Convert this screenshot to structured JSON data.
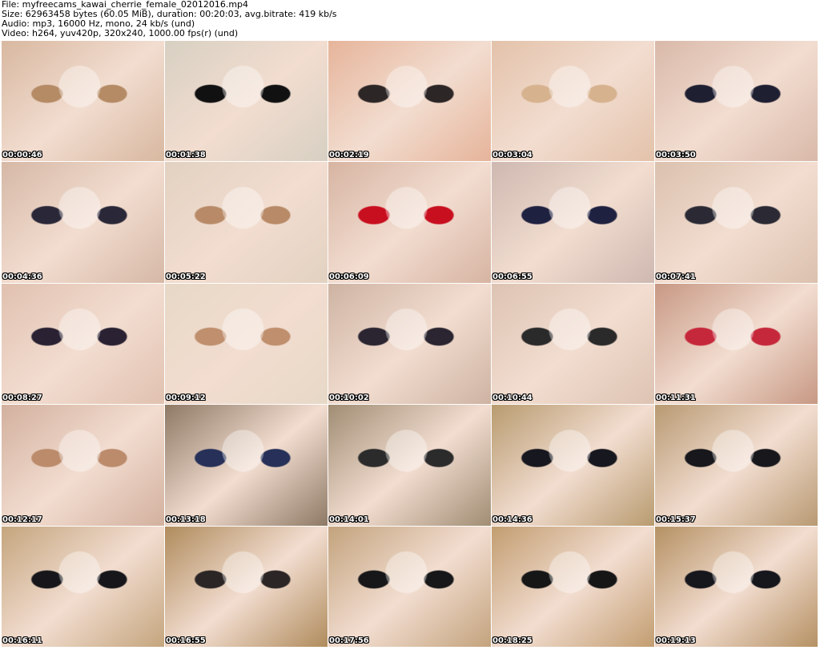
{
  "header": {
    "file_line": "File: myfreecams_kawai_cherrie_female_02012016.mp4",
    "size_line": "Size: 62963458 bytes (60.05 MiB), duration: 00:20:03, avg.bitrate: 419 kb/s",
    "audio_line": "Audio: mp3, 16000 Hz, mono, 24 kb/s (und)",
    "video_line": "Video: h264, yuv420p, 320x240, 1000.00 fps(r) (und)"
  },
  "thumbnails": [
    {
      "time": "00:00:46",
      "bg": "#d8b8a0",
      "accent": "#b58b66"
    },
    {
      "time": "00:01:38",
      "bg": "#d7d0c2",
      "accent": "#111111"
    },
    {
      "time": "00:02:19",
      "bg": "#e6b49a",
      "accent": "#2d2626"
    },
    {
      "time": "00:03:04",
      "bg": "#e3c2aa",
      "accent": "#d7b28f"
    },
    {
      "time": "00:03:50",
      "bg": "#d9b9a9",
      "accent": "#1f1f32"
    },
    {
      "time": "00:04:36",
      "bg": "#d6b8a6",
      "accent": "#2a2738"
    },
    {
      "time": "00:05:22",
      "bg": "#e2d1c1",
      "accent": "#b88a67"
    },
    {
      "time": "00:06:09",
      "bg": "#d7b4a2",
      "accent": "#c80f1f"
    },
    {
      "time": "00:06:55",
      "bg": "#ceb8b0",
      "accent": "#1f2140"
    },
    {
      "time": "00:07:41",
      "bg": "#dbc1ae",
      "accent": "#2b2a34"
    },
    {
      "time": "00:08:27",
      "bg": "#e1c1b0",
      "accent": "#2a2233"
    },
    {
      "time": "00:09:12",
      "bg": "#e7d8c6",
      "accent": "#bf8f6e"
    },
    {
      "time": "00:10:02",
      "bg": "#ceb3a2",
      "accent": "#2a2531"
    },
    {
      "time": "00:10:44",
      "bg": "#ddc3b2",
      "accent": "#2b2a2a"
    },
    {
      "time": "00:11:31",
      "bg": "#c79883",
      "accent": "#c6283b"
    },
    {
      "time": "00:12:17",
      "bg": "#d3b09e",
      "accent": "#bb8b6b"
    },
    {
      "time": "00:13:18",
      "bg": "#8e7965",
      "accent": "#263058"
    },
    {
      "time": "00:14:01",
      "bg": "#a08d73",
      "accent": "#2b2b2b"
    },
    {
      "time": "00:14:36",
      "bg": "#b89b6f",
      "accent": "#17171f"
    },
    {
      "time": "00:15:37",
      "bg": "#b89a72",
      "accent": "#17171c"
    },
    {
      "time": "00:16:11",
      "bg": "#c4a57d",
      "accent": "#17171b"
    },
    {
      "time": "00:16:55",
      "bg": "#b08c5d",
      "accent": "#2b2525"
    },
    {
      "time": "00:17:56",
      "bg": "#c3a37d",
      "accent": "#171719"
    },
    {
      "time": "00:18:25",
      "bg": "#c29d70",
      "accent": "#161617"
    },
    {
      "time": "00:19:13",
      "bg": "#b59163",
      "accent": "#16161d"
    }
  ]
}
